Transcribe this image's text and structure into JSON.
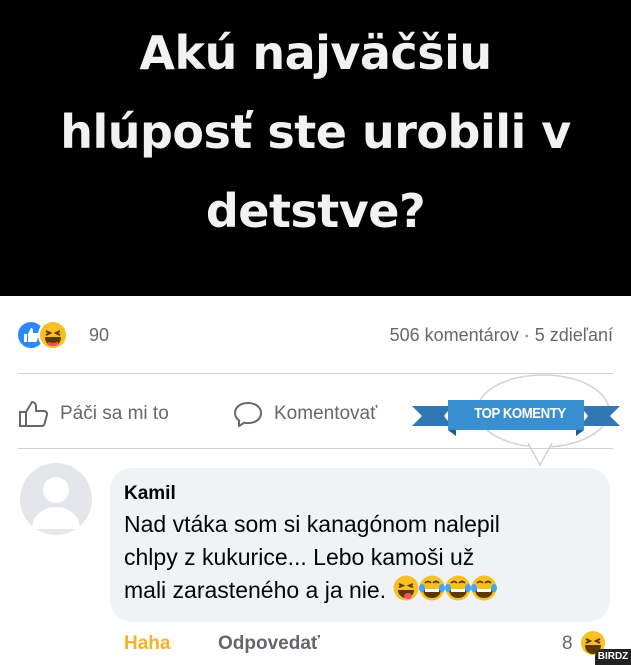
{
  "banner": {
    "title_lines": [
      "Akú najväčšiu",
      "hlúposť ste urobili v",
      "detstve?"
    ]
  },
  "post_stats": {
    "reaction_icons": [
      "like-icon",
      "haha-icon"
    ],
    "reaction_count": "90",
    "comments_shares": "506 komentárov · 5 zdieľaní"
  },
  "actions": {
    "like_label": "Páči sa mi to",
    "comment_label": "Komentovať"
  },
  "badge": {
    "text": "TOP KOMENTY",
    "ribbon_color": "#3a8fd0"
  },
  "comment": {
    "author": "Kamil",
    "text_lines": [
      "Nad vtáka som si kanagónom nalepil",
      "chlpy z kukurice... Lebo kamoši už",
      "mali zarasteného a ja nie."
    ],
    "emojis": [
      "tongue-laugh-emoji",
      "laugh-tears-emoji",
      "laugh-tears-emoji",
      "laugh-tears-emoji"
    ],
    "reaction_label": "Haha",
    "reply_label": "Odpovedať",
    "reaction_count": "8"
  },
  "watermark": "BIRDZ",
  "colors": {
    "banner": "#000000",
    "like_blue": "#2d88ff",
    "haha_yellow": "#f7b125",
    "muted_text": "#65676b",
    "bubble_bg": "#f0f2f5"
  }
}
